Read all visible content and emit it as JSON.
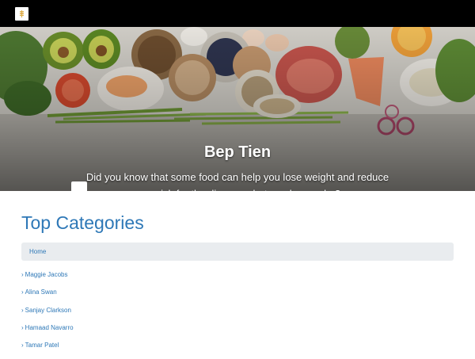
{
  "header": {
    "logo_icon": "grain-logo-icon"
  },
  "hero": {
    "title": "Bep Tien",
    "description": "Did you know that some food can help you lose weight and reduce your risk for the disease - but you know why?"
  },
  "categories": {
    "title": "Top Categories",
    "breadcrumb": "Home",
    "items": [
      "Maggie Jacobs",
      "Alina Swan",
      "Sanjay Clarkson",
      "Hamaad Navarro",
      "Tamar Patel"
    ]
  },
  "colors": {
    "accent": "#2e78b7",
    "topbar": "#000000",
    "breadcrumb_bg": "#e9ecef"
  }
}
